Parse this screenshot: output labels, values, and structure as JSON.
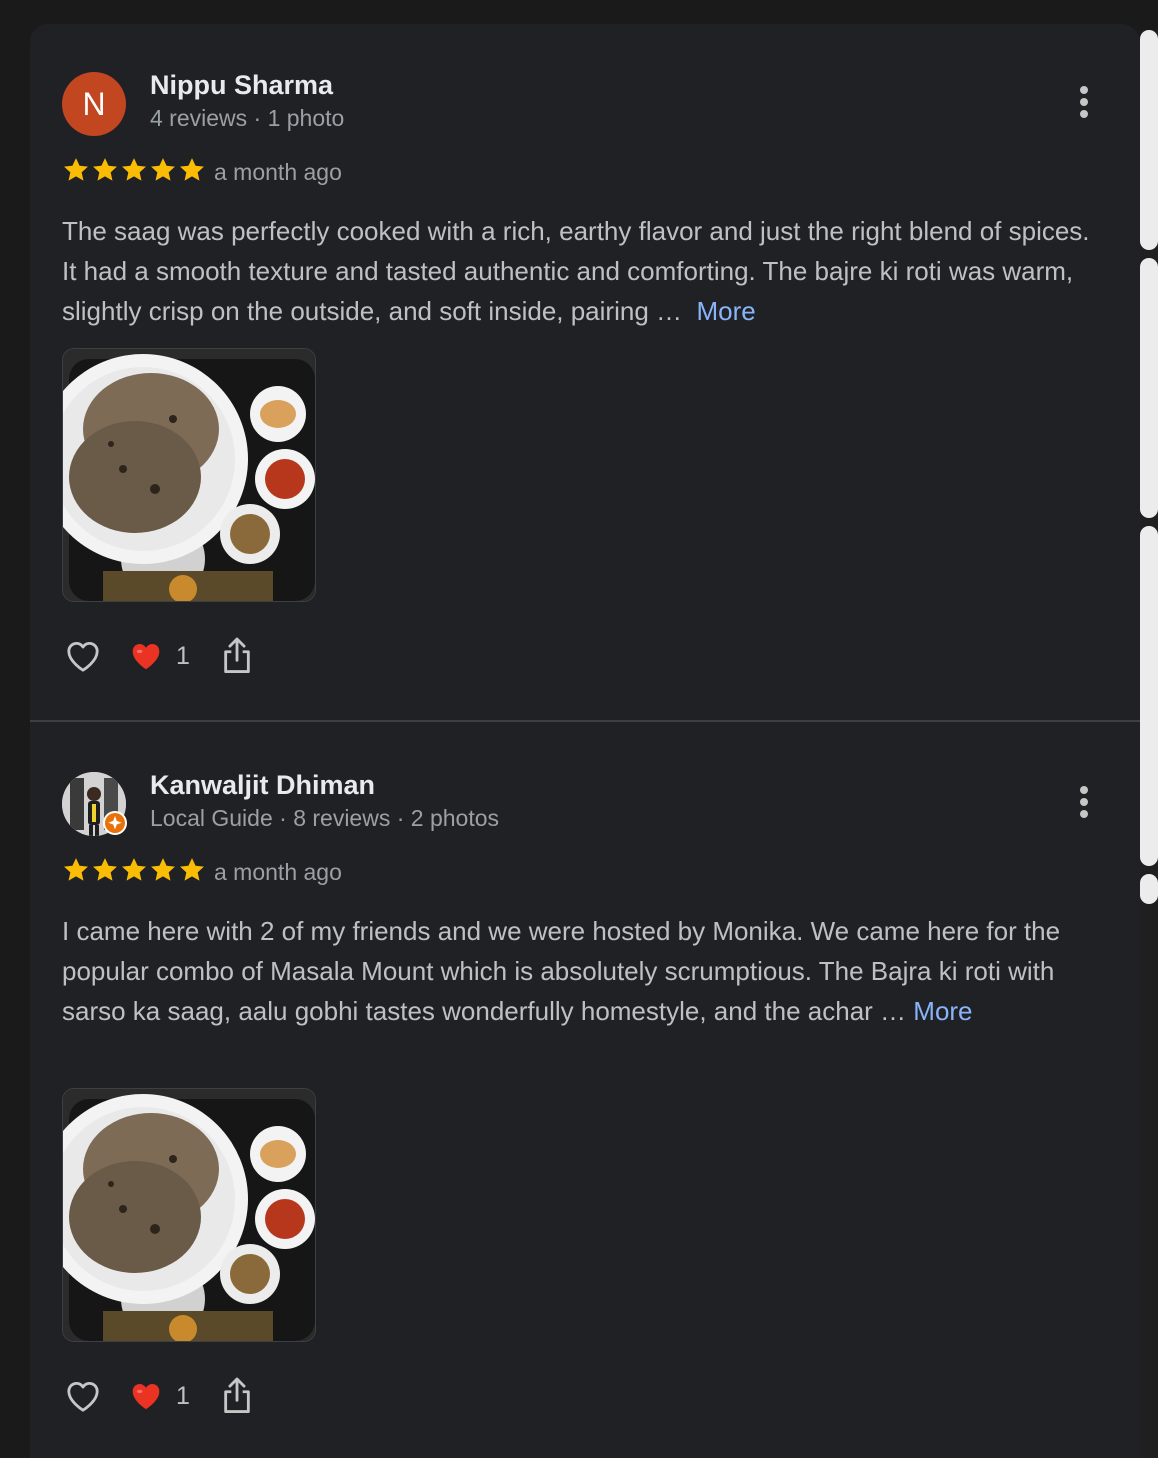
{
  "colors": {
    "background": "#202124",
    "star": "#fbbc04",
    "link": "#8ab4f8",
    "heart_red": "#ea3323",
    "avatar_letter_bg": "#c2461f"
  },
  "reviews": [
    {
      "avatar_letter": "N",
      "name": "Nippu Sharma",
      "meta": "4 reviews · 1 photo",
      "rating": 5,
      "date": "a month ago",
      "text": "The saag was perfectly cooked with a rich, earthy flavor and just the right blend of spices. It had a smooth texture and tasted authentic and comforting. The bajre ki roti was warm, slightly crisp on the outside, and soft inside, pairing …",
      "more_label": "More",
      "reaction_count": "1",
      "icons": {
        "like": "heart-outline-icon",
        "reaction": "red-heart-icon",
        "share": "share-icon",
        "menu": "more-vert-icon"
      }
    },
    {
      "avatar_letter": "",
      "name": "Kanwaljit Dhiman",
      "meta": "Local Guide · 8 reviews · 2 photos",
      "rating": 5,
      "date": "a month ago",
      "text": "I came here with 2 of my friends and we were hosted by Monika. We came here for the popular combo of Masala Mount which is absolutely scrumptious. The Bajra ki roti with sarso ka saag, aalu gobhi tastes wonderfully homestyle, and the achar …",
      "more_label": "More",
      "reaction_count": "1",
      "icons": {
        "like": "heart-outline-icon",
        "reaction": "red-heart-icon",
        "share": "share-icon",
        "menu": "more-vert-icon",
        "badge": "local-guide-star-icon"
      }
    }
  ]
}
